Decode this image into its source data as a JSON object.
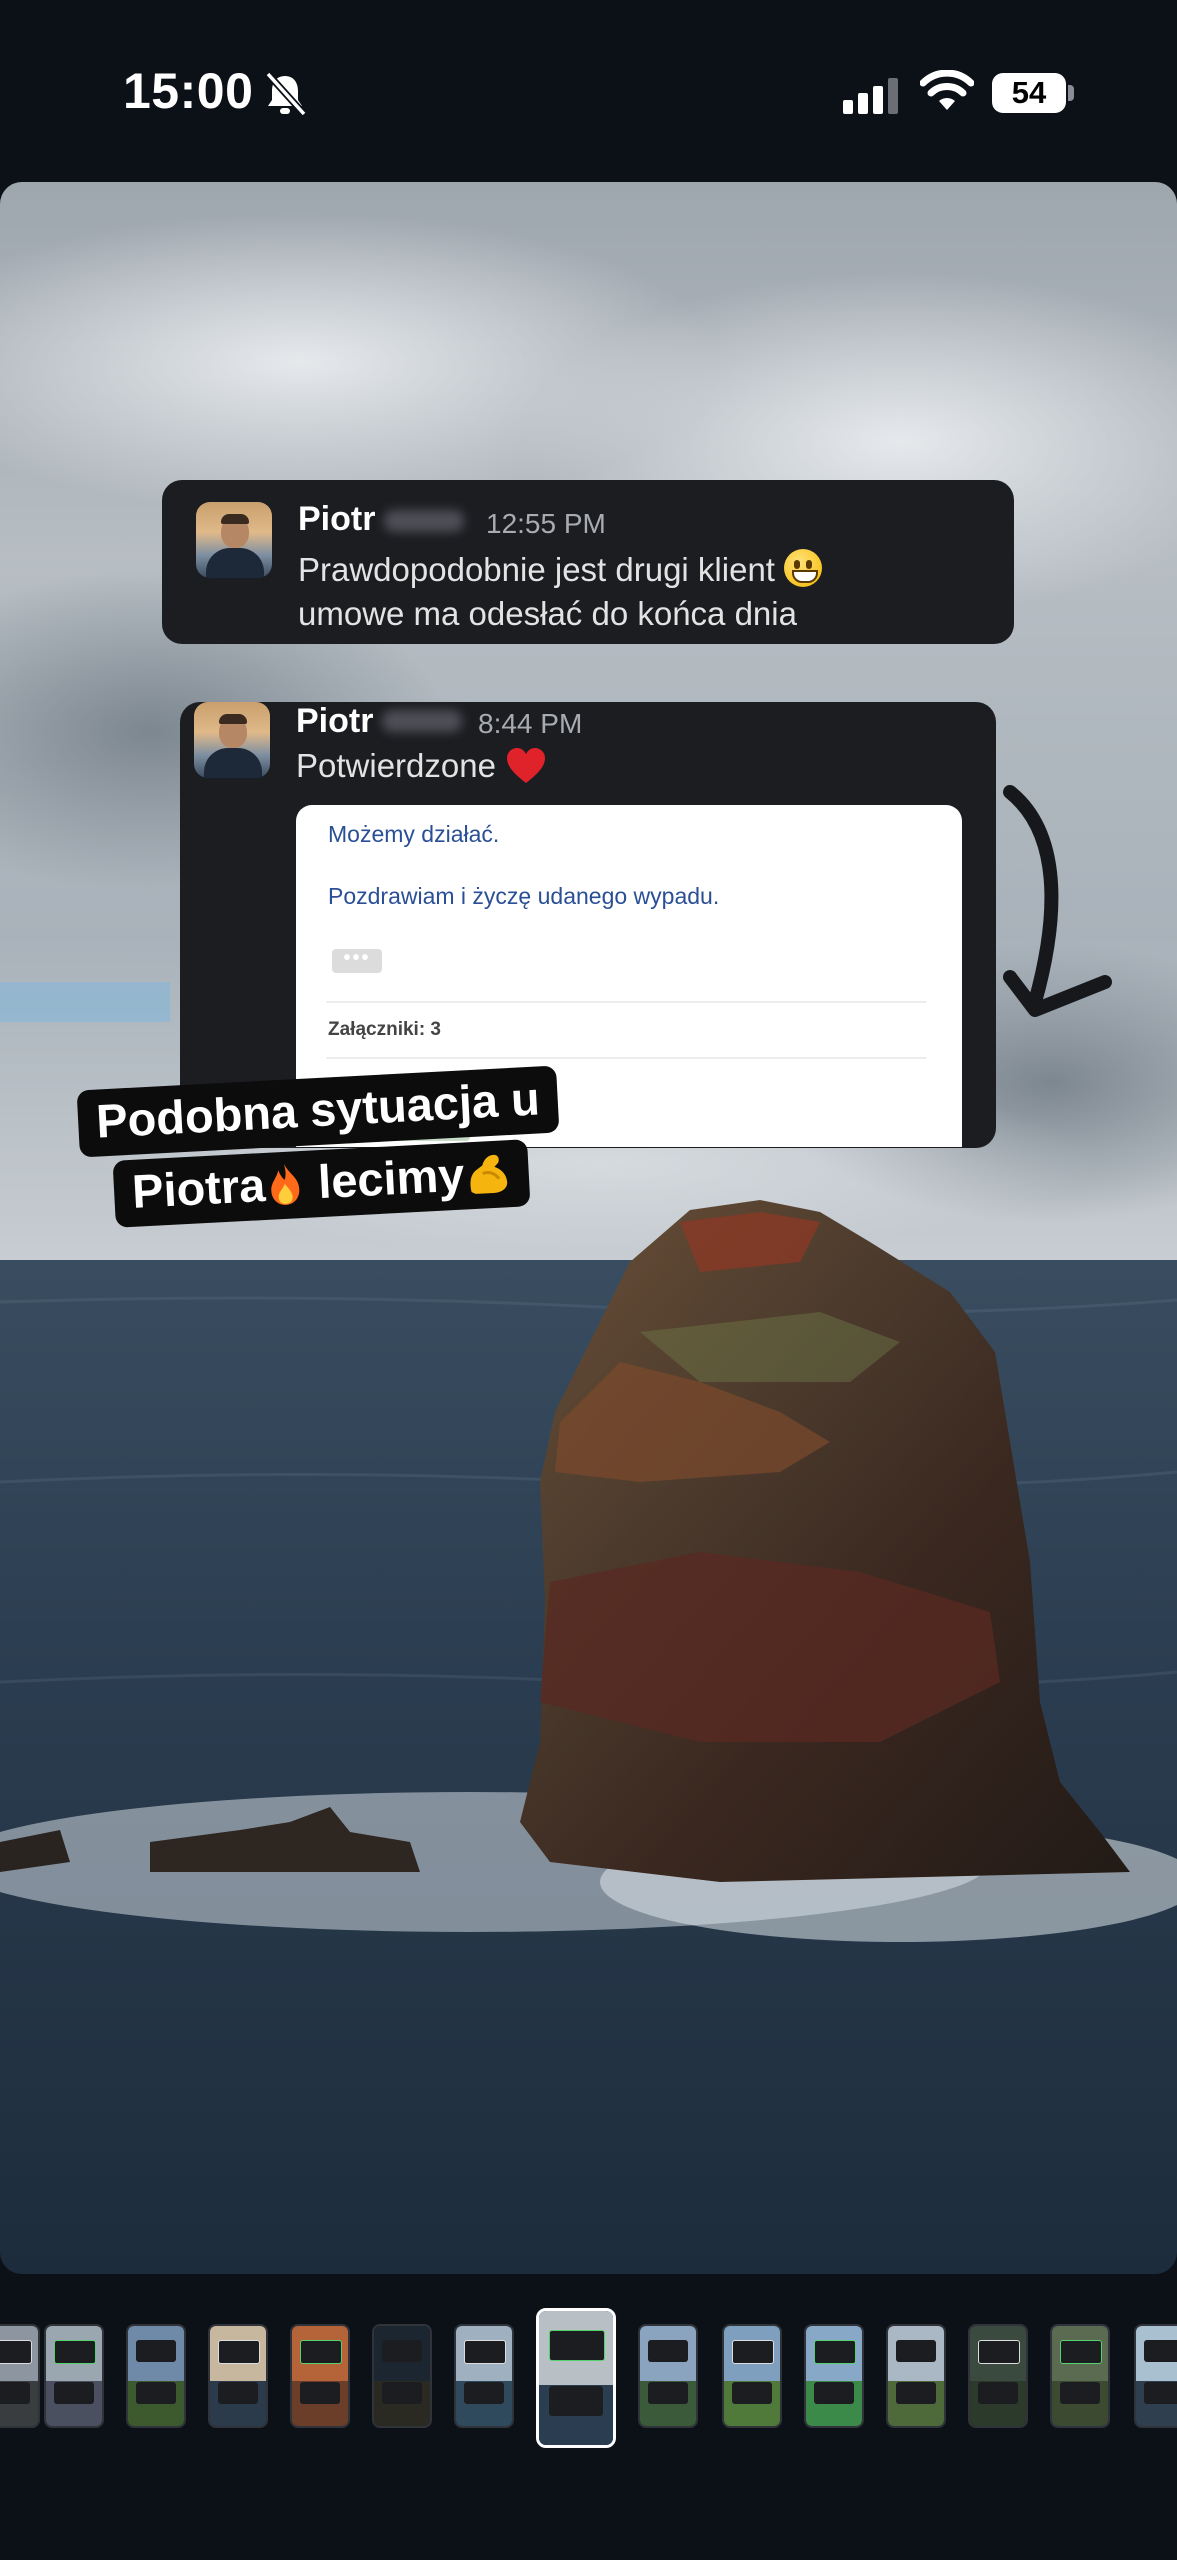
{
  "status_bar": {
    "time": "15:00",
    "bell_icon": "bell-slash-icon",
    "signal_icon": "cellular-signal-icon",
    "wifi_icon": "wifi-icon",
    "battery_level": "54"
  },
  "messages": [
    {
      "sender": "Piotr",
      "time": "12:55 PM",
      "text_line1": "Prawdopodobnie jest drugi klient",
      "emoji": "grinning-face-icon",
      "text_line2": "umowe ma odesłać do końca dnia"
    },
    {
      "sender": "Piotr",
      "time": "8:44 PM",
      "text": "Potwierdzone",
      "emoji": "red-heart-icon",
      "email": {
        "line1": "Możemy działać.",
        "line2": "Pozdrawiam i życzę udanego wypadu.",
        "ellipsis": "•••",
        "attachments": "Załączniki: 3"
      }
    }
  ],
  "caption": {
    "line1": "Podobna sytuacja u",
    "line2_a": "Piotra",
    "line2_b": " lecimy",
    "icon1": "fire-icon",
    "icon2": "flexed-biceps-icon"
  },
  "thumbnails": {
    "count": 15,
    "selected_index": 7
  },
  "colors": {
    "background": "#0c1118",
    "card": "#1b1d21",
    "email_link": "#2a4f96"
  }
}
